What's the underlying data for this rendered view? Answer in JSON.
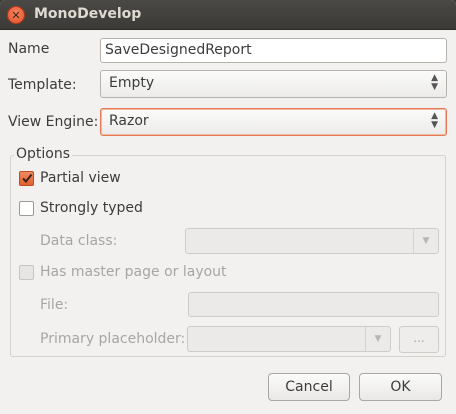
{
  "window": {
    "title": "MonoDevelop"
  },
  "form": {
    "name_label": "Name",
    "name_value": "SaveDesignedReport",
    "template_label": "Template:",
    "template_value": "Empty",
    "engine_label": "View Engine:",
    "engine_value": "Razor"
  },
  "options": {
    "label": "Options",
    "partial_view": {
      "label": "Partial view",
      "checked": true
    },
    "strongly_typed": {
      "label": "Strongly typed",
      "checked": false
    },
    "data_class_label": "Data class:",
    "master_page": {
      "label": "Has master page or layout",
      "checked": false
    },
    "file_label": "File:",
    "placeholder_label": "Primary placeholder:",
    "browse_label": "..."
  },
  "buttons": {
    "cancel": "Cancel",
    "ok": "OK"
  },
  "colors": {
    "accent": "#e2602f",
    "titlebar": "#3c3b37"
  }
}
